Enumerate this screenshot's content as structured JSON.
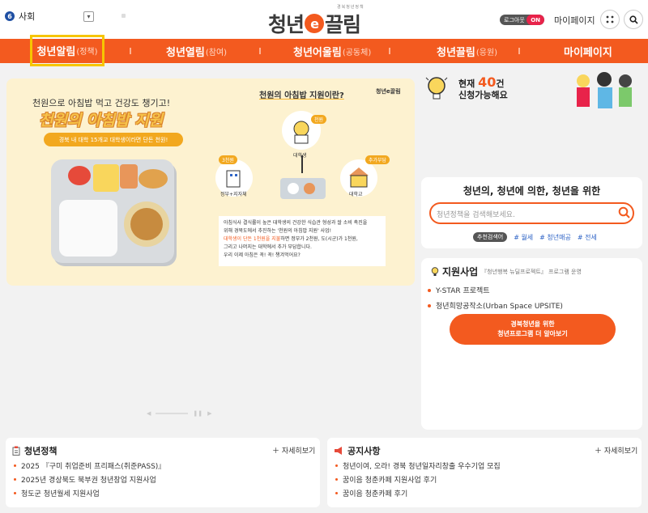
{
  "header": {
    "region_number": "6",
    "region_label": "사회",
    "logo_sub": "경북청년정책",
    "logo_text_a": "청년",
    "logo_text_e": "e",
    "logo_text_b": "끌림",
    "toggle_label": "로그아웃",
    "toggle_state": "ON",
    "mypage_label": "마이페이지"
  },
  "nav": {
    "items": [
      {
        "label": "청년알림",
        "sub": "(정책)"
      },
      {
        "label": "청년열림",
        "sub": "(참여)"
      },
      {
        "label": "청년어울림",
        "sub": "(공동체)"
      },
      {
        "label": "청년끌림",
        "sub": "(응원)"
      },
      {
        "label": "마이페이지",
        "sub": ""
      }
    ]
  },
  "banner": {
    "line1": "천원으로 아침밥 먹고 건강도 챙기고!",
    "title": "천원의 아침밥 지원",
    "pill": "경북 내 대학 15개교 대학생이라면 단돈 천원!",
    "question": "천원의 아침밥 지원이란?",
    "logo": "청년e끌림",
    "tag_student": "천원",
    "label_student": "대학생",
    "tag_gov": "3천원",
    "label_gov": "정부+지자체",
    "tag_univ": "추가부담",
    "label_univ": "대학교",
    "text1": "아침식사 결식률이 높은 대학생의 건강한 식습관 형성과 쌀 소비 촉진을",
    "text2": "위해 경북도에서 추진하는 '천원의 아침밥 지원' 사업!",
    "text3_o": "대학생이 단돈 1천원을 지불",
    "text3": "하면 정부가 2천원, 도(시군)가 1천원,",
    "text4": "그리고 나머지는 대학에서 추가 부담합니다.",
    "text5": "우리 이제 아침은 꼭! 꼭! 챙겨먹어요?"
  },
  "promo": {
    "prefix": "현재",
    "count": "40",
    "unit": "건",
    "line2": "신청가능해요"
  },
  "search": {
    "title": "청년의, 청년에 의한, 청년을 위한",
    "placeholder": "청년정책을 검색해보세요.",
    "rec_label": "추천검색어",
    "tags": [
      "# 월세",
      "# 청년매공",
      "# 전세"
    ]
  },
  "support": {
    "title": "지원사업",
    "subtitle": "『청년행복 뉴딜프로젝트』 프로그램 운영",
    "items": [
      "Y-STAR 프로젝트",
      "청년희망공작소(Urban Space UPSITE)"
    ],
    "button_line1": "경북청년을 위한",
    "button_line2": "청년프로그램 더 알아보기"
  },
  "policy": {
    "title": "청년정책",
    "more": "자세히보기",
    "items": [
      "2025 『구미 취업준비 프리패스(취준PASS)』",
      "2025년 경상북도 북부권 청년창업 지원사업",
      "청도군 청년월세 지원사업"
    ]
  },
  "notice": {
    "title": "공지사항",
    "more": "자세히보기",
    "items": [
      "청년이여, 오라! 경북 청년일자리창출 우수기업 모집",
      "꿈이음 청춘카페 지원사업 후기",
      "꿈이음 청춘카페 후기"
    ]
  },
  "colors": {
    "accent": "#f35a1f",
    "highlight": "#f6c500",
    "banner_bg": "#fdf2d0"
  }
}
